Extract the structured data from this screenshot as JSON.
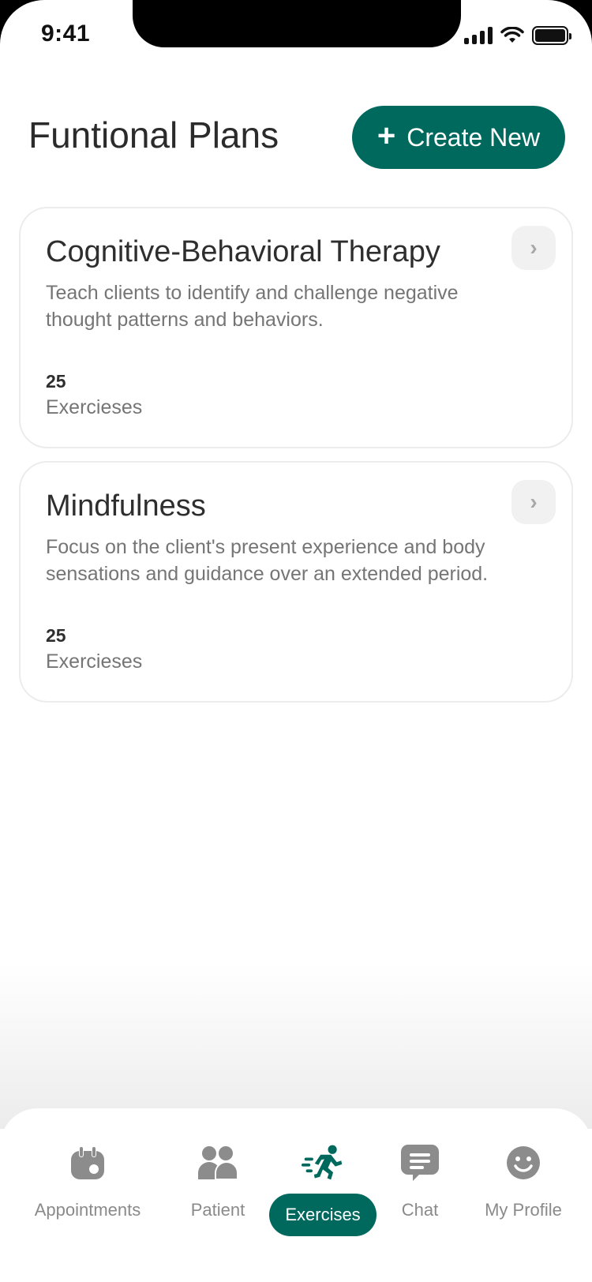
{
  "status_bar": {
    "time": "9:41"
  },
  "header": {
    "title": "Funtional Plans",
    "create_button": {
      "icon": "plus-icon",
      "label": "Create New"
    }
  },
  "plans": [
    {
      "title": "Cognitive-Behavioral Therapy",
      "description": "Teach clients to identify and challenge negative thought patterns and behaviors.",
      "count": "25",
      "count_label": "Exercieses"
    },
    {
      "title": "Mindfulness",
      "description": "Focus on the client's present experience and body sensations and guidance over an extended period.",
      "count": "25",
      "count_label": "Exercieses"
    }
  ],
  "bottom_nav": {
    "items": [
      {
        "label": "Appointments",
        "icon": "calendar-icon",
        "active": false
      },
      {
        "label": "Patient",
        "icon": "people-icon",
        "active": false
      },
      {
        "label": "Exercises",
        "icon": "running-icon",
        "active": true
      },
      {
        "label": "Chat",
        "icon": "chat-icon",
        "active": false
      },
      {
        "label": "My Profile",
        "icon": "smiley-icon",
        "active": false
      }
    ]
  },
  "colors": {
    "accent": "#00695e",
    "icon_gray": "#8c8c8c",
    "text_dark": "#2e2e2e",
    "text_muted": "#757575"
  }
}
